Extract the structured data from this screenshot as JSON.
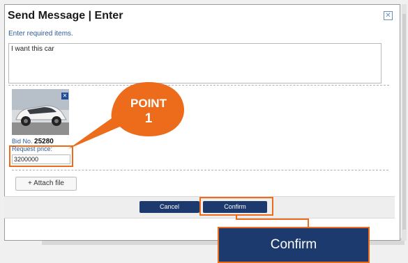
{
  "dialog": {
    "title": "Send Message | Enter",
    "subtitle": "Enter required items.",
    "close_icon": "close-x-icon"
  },
  "message": {
    "value": "I want this car"
  },
  "item": {
    "bid_label": "Bid No.",
    "bid_number": "25280",
    "request_price_label": "Request price:",
    "request_price_value": "3200000",
    "thumbnail_icon": "car-photo",
    "select_icon": "check-box-icon"
  },
  "attach": {
    "label": "+ Attach file"
  },
  "footer": {
    "cancel_label": "Cancel",
    "confirm_label": "Confirm"
  },
  "callout": {
    "point_label": "POINT",
    "point_number": "1",
    "zoom_confirm_label": "Confirm"
  },
  "colors": {
    "accent_orange": "#ec6c1b",
    "button_navy": "#1c3a6d",
    "link_blue": "#2d5a96"
  }
}
